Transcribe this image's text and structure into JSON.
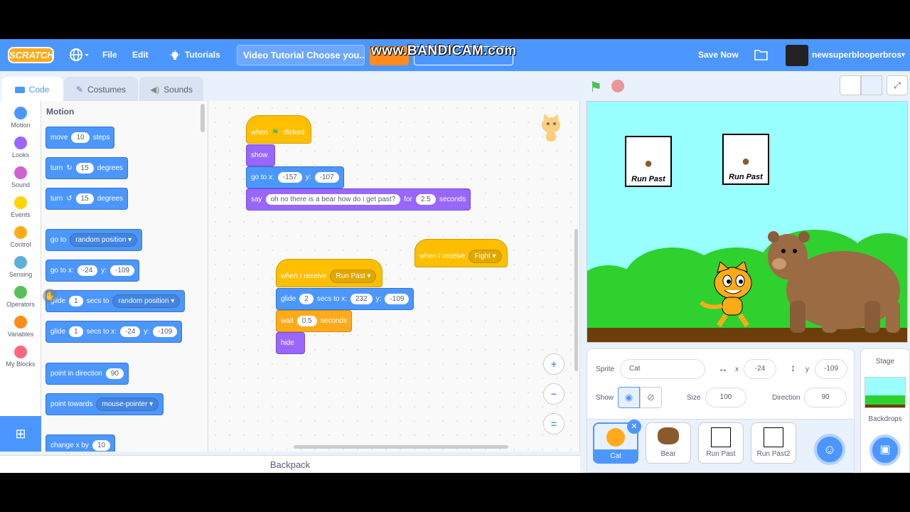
{
  "menubar": {
    "logo": "SCRATCH",
    "file": "File",
    "edit": "Edit",
    "tutorials": "Tutorials",
    "project_title": "Video Tutorial Choose you...",
    "watermark": "www.BANDICAM.com",
    "save": "Save Now",
    "username": "newsuperblooperbros"
  },
  "tabs": {
    "code": "Code",
    "costumes": "Costumes",
    "sounds": "Sounds"
  },
  "categories": [
    "Motion",
    "Looks",
    "Sound",
    "Events",
    "Control",
    "Sensing",
    "Operators",
    "Variables",
    "My Blocks"
  ],
  "category_colors": [
    "#4c97ff",
    "#9966ff",
    "#cf63cf",
    "#ffd500",
    "#ffab19",
    "#5cb1d6",
    "#59c059",
    "#ff8c1a",
    "#ff6680"
  ],
  "palette": {
    "title": "Motion",
    "move": {
      "a": "move",
      "v": "10",
      "b": "steps"
    },
    "turn_r": {
      "a": "turn",
      "v": "15",
      "b": "degrees"
    },
    "turn_l": {
      "a": "turn",
      "v": "15",
      "b": "degrees"
    },
    "goto_random": {
      "a": "go to",
      "d": "random position"
    },
    "goto_xy": {
      "a": "go to x:",
      "x": "-24",
      "b": "y:",
      "y": "-109"
    },
    "glide_random": {
      "a": "glide",
      "v": "1",
      "b": "secs to",
      "d": "random position"
    },
    "glide_xy": {
      "a": "glide",
      "v": "1",
      "b": "secs to x:",
      "x": "-24",
      "c": "y:",
      "y": "-109"
    },
    "point_dir": {
      "a": "point in direction",
      "v": "90"
    },
    "point_towards": {
      "a": "point towards",
      "d": "mouse-pointer"
    },
    "change_x": {
      "a": "change x by",
      "v": "10"
    }
  },
  "script1": {
    "hat_a": "when",
    "hat_b": "clicked",
    "show": "show",
    "goto": {
      "a": "go to x:",
      "x": "-157",
      "b": "y:",
      "y": "-107"
    },
    "say": {
      "a": "say",
      "msg": "oh no there is a bear how do i get past?",
      "b": "for",
      "v": "2.5",
      "c": "seconds"
    }
  },
  "script2": {
    "hat": "when I receive",
    "msg": "Fight"
  },
  "script3": {
    "hat": "when I receive",
    "msg": "Run Past",
    "glide": {
      "a": "glide",
      "v": "2",
      "b": "secs to x:",
      "x": "232",
      "c": "y:",
      "y": "-109"
    },
    "wait": {
      "a": "wait",
      "v": "0.5",
      "b": "seconds"
    },
    "hide": "hide"
  },
  "zoom": {
    "in": "+",
    "out": "−",
    "reset": "="
  },
  "backpack": "Backpack",
  "stage": {
    "sign1": "Run Past",
    "sign2": "Run Past"
  },
  "sprite_info": {
    "sprite_label": "Sprite",
    "sprite_name": "Cat",
    "x_label": "x",
    "x": "-24",
    "y_label": "y",
    "y": "-109",
    "show_label": "Show",
    "size_label": "Size",
    "size": "100",
    "dir_label": "Direction",
    "dir": "90"
  },
  "sprites": [
    "Cat",
    "Bear",
    "Run Past",
    "Run Past2"
  ],
  "stage_panel": {
    "title": "Stage",
    "backdrops": "Backdrops"
  }
}
